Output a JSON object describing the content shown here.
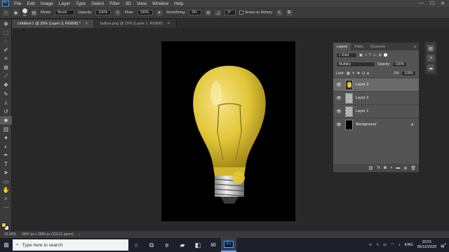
{
  "menubar": {
    "app_logo": "Ps",
    "items": [
      "File",
      "Edit",
      "Image",
      "Layer",
      "Type",
      "Select",
      "Filter",
      "3D",
      "View",
      "Window",
      "Help"
    ],
    "window_controls": [
      "—",
      "☐",
      "✕"
    ]
  },
  "options": {
    "brush_size": "80",
    "mode_label": "Mode:",
    "mode_value": "Brush",
    "opacity_label": "Opacity:",
    "opacity_value": "100%",
    "flow_label": "Flow:",
    "flow_value": "100%",
    "smoothing_label": "Smoothing:",
    "smoothing_value": "0%",
    "angle_value": "0°",
    "erase_history_label": "Erase to History"
  },
  "tabs": [
    {
      "label": "Untitled-1 @ 29% (Layer 3, RGB/8) *",
      "active": true
    },
    {
      "label": "bulbss.png @ 25% (Layer 1, RGB/8)",
      "active": false
    }
  ],
  "tools": [
    "move-icon",
    "marquee-icon",
    "lasso-icon",
    "quick-select-icon",
    "crop-icon",
    "frame-icon",
    "eyedropper-icon",
    "spot-heal-icon",
    "brush-icon",
    "stamp-icon",
    "history-brush-icon",
    "eraser-icon",
    "gradient-icon",
    "blur-icon",
    "dodge-icon",
    "pen-icon",
    "type-icon",
    "path-select-icon",
    "shape-icon",
    "hand-icon",
    "zoom-icon",
    "more-icon"
  ],
  "colors": {
    "foreground": "#e8c84a",
    "background": "#ffffff",
    "bulb": "#e2c637"
  },
  "status": {
    "zoom": "29.02%",
    "doc_info": "3457 px x 3890 px (118.11 ppcm)"
  },
  "layers_panel": {
    "tabs": [
      "Layers",
      "Paths",
      "Channels"
    ],
    "filter_label": "Kind",
    "blend_mode": "Multiply",
    "opacity_label": "Opacity:",
    "opacity_value": "100%",
    "lock_label": "Lock:",
    "fill_label": "Fill:",
    "fill_value": "100%",
    "layers": [
      {
        "name": "Layer 3",
        "active": true,
        "thumb": "bulb"
      },
      {
        "name": "Layer 2",
        "active": false,
        "thumb": "checker"
      },
      {
        "name": "Layer 1",
        "active": false,
        "thumb": "checker"
      },
      {
        "name": "Background",
        "active": false,
        "thumb": "black",
        "locked": true
      }
    ]
  },
  "taskbar": {
    "search_placeholder": "Type here to search",
    "language": "ENG",
    "time": "20:51",
    "date": "06/12/2020",
    "notifications": "2"
  }
}
